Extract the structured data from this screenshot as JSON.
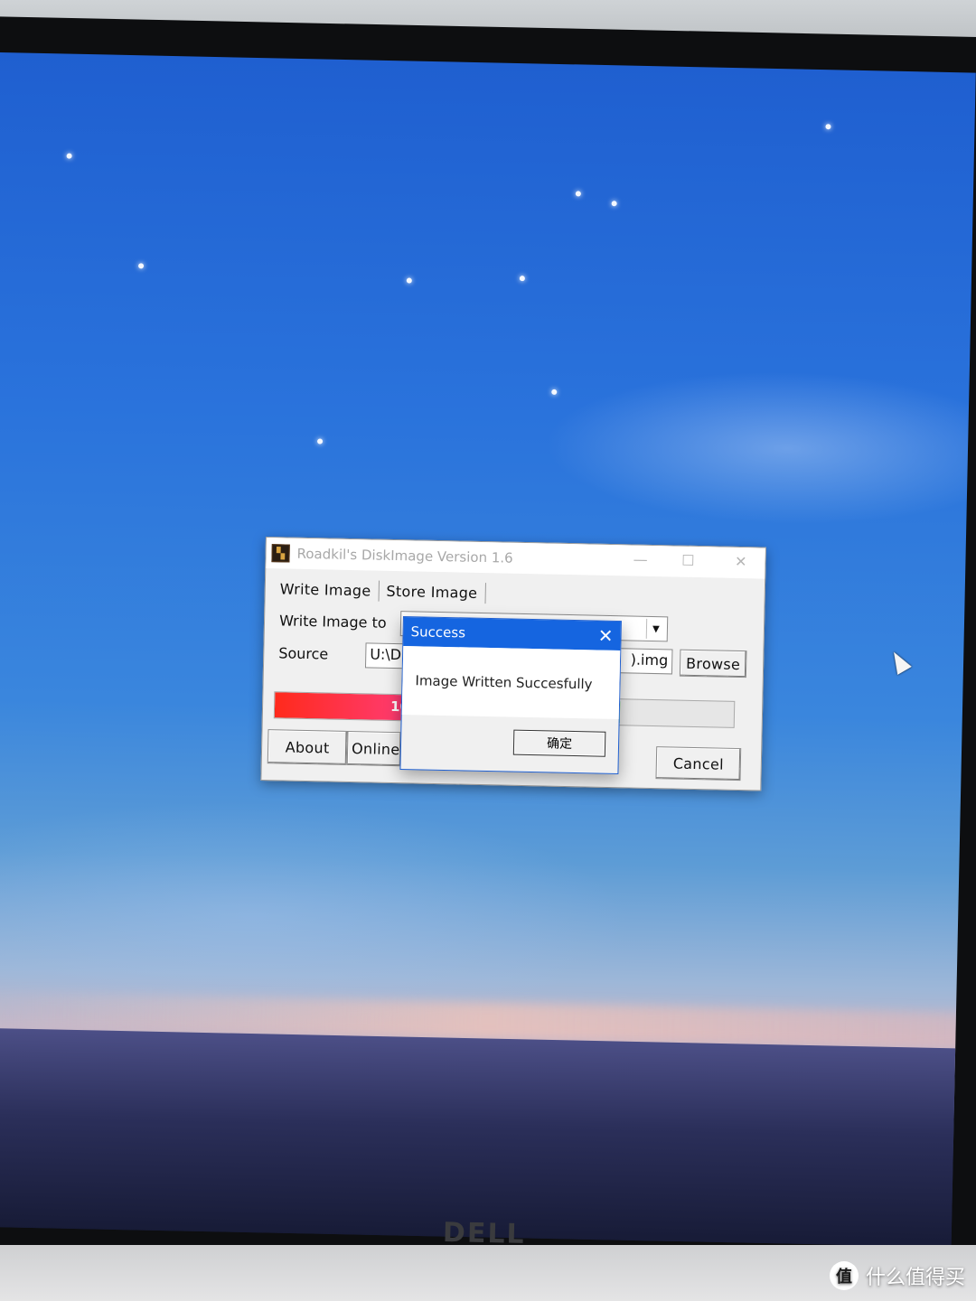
{
  "app": {
    "title": "Roadkil's DiskImage Version 1.6",
    "tabs": [
      "Write Image",
      "Store Image"
    ],
    "write_image_to_label": "Write Image to",
    "source_label": "Source",
    "source_value": "U:\\D",
    "file_suffix": ").img",
    "browse_label": "Browse",
    "progress_text": "10",
    "progress_fraction": 0.73,
    "buttons": {
      "about": "About",
      "online": "Online",
      "cancel": "Cancel"
    }
  },
  "dialog": {
    "title": "Success",
    "message": "Image Written Succesfully",
    "ok_label": "确定"
  },
  "monitor": {
    "brand": "DELL"
  },
  "watermark": {
    "icon_text": "值",
    "text": "什么值得买"
  },
  "colors": {
    "dialog_title_bar": "#1565e0",
    "progress_start": "#ff2a1c",
    "progress_end": "#5b2ce8"
  }
}
